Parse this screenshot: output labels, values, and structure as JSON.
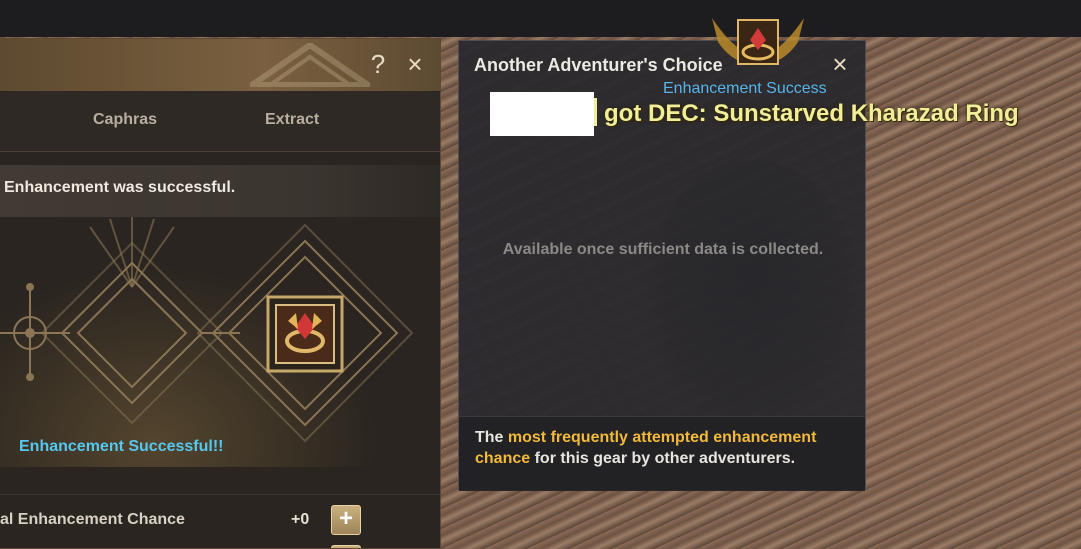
{
  "left_panel": {
    "help_label": "?",
    "close_label": "×",
    "tabs": [
      {
        "label": "Caphras"
      },
      {
        "label": "Extract"
      }
    ],
    "status_message": "Enhancement was successful.",
    "success_banner": "Enhancement Successful!!",
    "chance_label": "al Enhancement Chance",
    "chance_value": "+0",
    "add_label": "+"
  },
  "popup": {
    "title": "Another Adventurer's Choice",
    "close_label": "×",
    "empty_message": "Available once sufficient data is collected.",
    "footer": {
      "prefix": "The ",
      "highlight1": "most frequently attempted enhancement",
      "highlight2": "chance",
      "suffix": " for this gear by other adventurers."
    }
  },
  "notification": {
    "subtitle": "Enhancement Success",
    "message": "got DEC: Sunstarved Kharazad Ring"
  },
  "colors": {
    "accent_blue": "#55c8f0",
    "highlight_gold": "#f2b93a",
    "notification_text": "#f1ee9a"
  }
}
